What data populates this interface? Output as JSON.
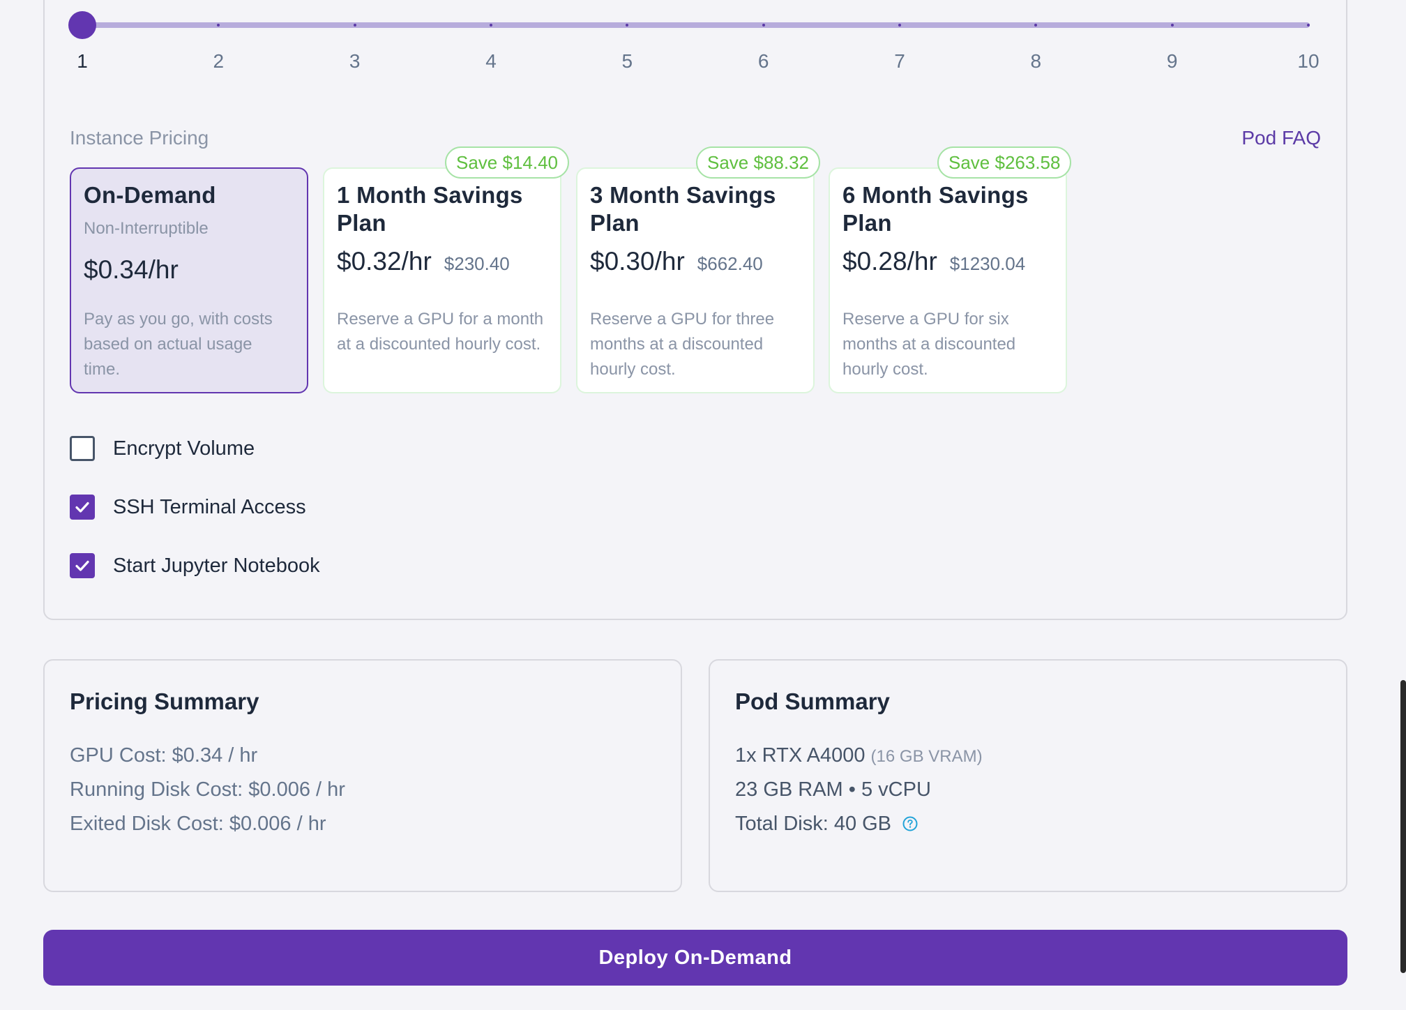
{
  "gpu_count_slider": {
    "value": 1,
    "min": 1,
    "max": 10,
    "ticks": [
      "1",
      "2",
      "3",
      "4",
      "5",
      "6",
      "7",
      "8",
      "9",
      "10"
    ]
  },
  "pricing": {
    "section_label": "Instance Pricing",
    "faq_link": "Pod FAQ",
    "plans": [
      {
        "title_line1": "On-Demand",
        "title_line2": "",
        "subtitle": "Non-Interruptible",
        "price": "$0.34/hr",
        "total": "",
        "description": "Pay as you go, with costs based on actual usage time.",
        "badge": "",
        "selected": true
      },
      {
        "title_line1": "1 Month Savings",
        "title_line2": "Plan",
        "subtitle": "",
        "price": "$0.32/hr",
        "total": "$230.40",
        "description": "Reserve a GPU for a month at a discounted hourly cost.",
        "badge": "Save $14.40",
        "selected": false
      },
      {
        "title_line1": "3 Month Savings",
        "title_line2": "Plan",
        "subtitle": "",
        "price": "$0.30/hr",
        "total": "$662.40",
        "description": "Reserve a GPU for three months at a discounted hourly cost.",
        "badge": "Save $88.32",
        "selected": false
      },
      {
        "title_line1": "6 Month Savings",
        "title_line2": "Plan",
        "subtitle": "",
        "price": "$0.28/hr",
        "total": "$1230.04",
        "description": "Reserve a GPU for six months at a discounted hourly cost.",
        "badge": "Save $263.58",
        "selected": false
      }
    ]
  },
  "options": [
    {
      "label": "Encrypt Volume",
      "checked": false
    },
    {
      "label": "SSH Terminal Access",
      "checked": true
    },
    {
      "label": "Start Jupyter Notebook",
      "checked": true
    }
  ],
  "pricing_summary": {
    "title": "Pricing Summary",
    "lines": [
      "GPU Cost: $0.34 / hr",
      "Running Disk Cost: $0.006 / hr",
      "Exited Disk Cost: $0.006 / hr"
    ]
  },
  "pod_summary": {
    "title": "Pod Summary",
    "gpu": "1x RTX A4000",
    "vram": "(16 GB VRAM)",
    "resources": "23 GB RAM • 5 vCPU",
    "disk": "Total Disk: 40 GB",
    "help_icon": "question-circle-icon"
  },
  "deploy_button": "Deploy On-Demand",
  "colors": {
    "accent": "#6236b0",
    "save_green": "#5fbf3f",
    "background": "#f4f4f8"
  }
}
